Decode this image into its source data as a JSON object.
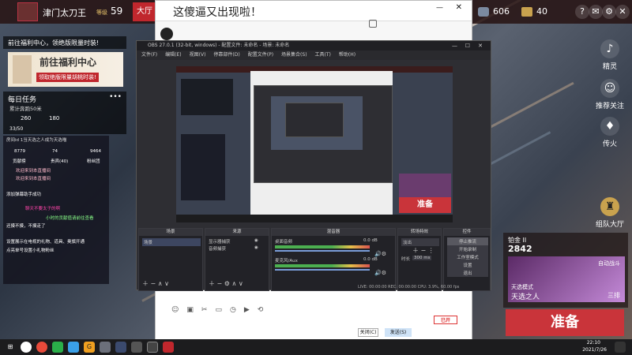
{
  "game_topbar": {
    "player_name": "津门太刀王",
    "rank_badge": "等级",
    "level": "59",
    "hall_button": "大厅",
    "currency_1": "606",
    "currency_2": "40"
  },
  "left_panel": {
    "banner_title": "前往福利中心，领绝版限量时装!",
    "banner_image_title": "前往福利中心",
    "banner_image_subtitle": "领取绝版限量胡桃时装!",
    "daily_title": "每日任务",
    "daily_desc": "累计奔跑50米",
    "stat_1": "260",
    "stat_2": "180",
    "progress": "33/50"
  },
  "chat": {
    "header": "房间id 1当天选之人成为天选喵",
    "stats": [
      "8779",
      "74",
      "9464"
    ],
    "tabs": [
      "贡献榜",
      "贵宾(40)",
      "粉丝团"
    ],
    "messages": [
      "欢迎来到本直播间",
      "欢迎来到本直播间",
      "添加弹幕助手成功",
      "聊天不要太子的啊",
      "小时的贡献值请前往查看",
      "还摸不摸，不摸走了",
      "设置展示在电视的礼物、道具、奥旗开通",
      "点亮单号设置小礼物粉丝"
    ]
  },
  "chat_window": {
    "title": "这傻逼又出现啦！",
    "send_button": "发送(S)",
    "close_button": "关闭(C)",
    "record_label": "已开"
  },
  "obs": {
    "title": "OBS 27.0.1 (32-bit, windows) - 配置文件: 未命名 - 场景: 未命名",
    "menu": [
      "文件(F)",
      "编辑(E)",
      "视图(V)",
      "停靠部件(D)",
      "配置文件(P)",
      "场景集合(S)",
      "工具(T)",
      "帮助(H)"
    ],
    "docks": {
      "scenes": {
        "title": "场景",
        "items": [
          "场景"
        ]
      },
      "sources": {
        "title": "来源",
        "items": [
          "显示器捕获",
          "音频捕获"
        ]
      },
      "mixer": {
        "title": "混音器",
        "channel_1": "桌面音频",
        "channel_2": "麦克风/Aux",
        "db_1": "0.0 dB",
        "db_2": "0.0 dB"
      },
      "transitions": {
        "title": "转场特效",
        "mode": "淡出",
        "duration_label": "时长",
        "duration": "300 ms"
      },
      "controls": {
        "title": "控件",
        "buttons": [
          "停止推流",
          "开始录制",
          "工作室模式",
          "设置",
          "退出"
        ]
      }
    },
    "status": "LIVE: 00:00:00   REC: 00:00:00   CPU: 3.9%, 60.00 fps"
  },
  "right_rail": {
    "items": [
      "精灵",
      "推荐关注",
      "传火",
      "组队大厅"
    ]
  },
  "match_panel": {
    "label": "铂金 II",
    "score": "2842",
    "mode": "天选模式",
    "chosen": "天选之人",
    "rank": "三排",
    "auto": "自动战斗",
    "ready_button": "准备"
  },
  "taskbar": {
    "time": "22:10",
    "date": "2021/7/26"
  }
}
